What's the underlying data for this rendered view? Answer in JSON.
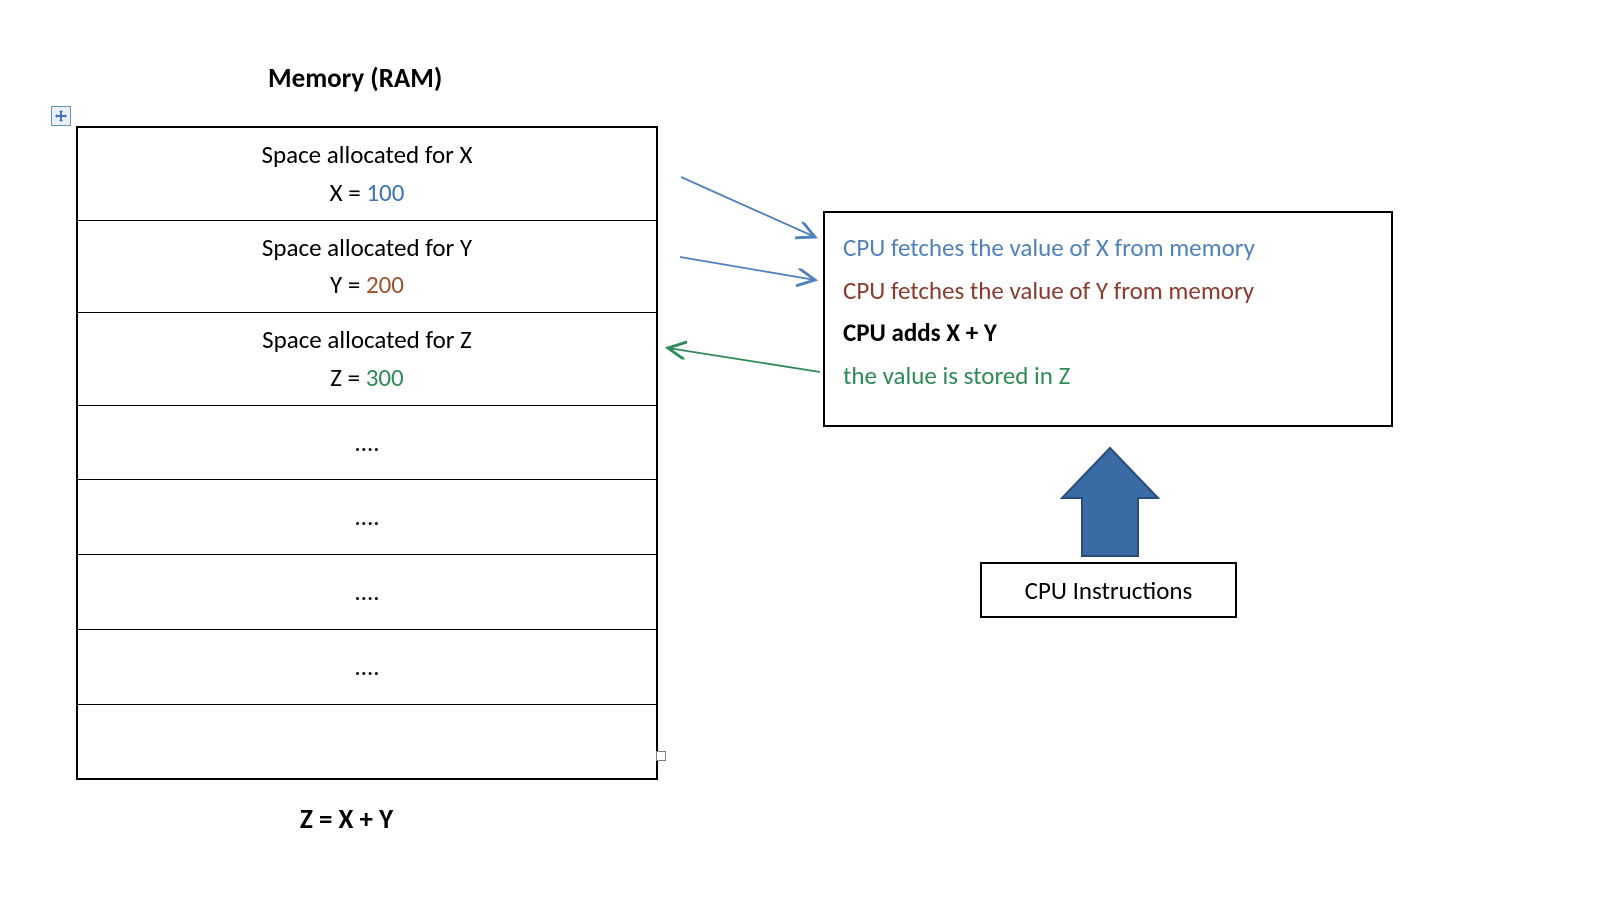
{
  "ram": {
    "title": "Memory (RAM)",
    "cells": [
      {
        "alloc": "Space allocated for X",
        "var": "X = ",
        "value": "100",
        "color": "c-blue"
      },
      {
        "alloc": "Space allocated for Y",
        "var": "Y = ",
        "value": "200",
        "color": "c-brown"
      },
      {
        "alloc": "Space allocated for Z",
        "var": "Z = ",
        "value": "300",
        "color": "c-green"
      }
    ],
    "ellipsis": "....",
    "equation": "Z = X + Y"
  },
  "steps": {
    "s1": "CPU fetches the value of X from memory",
    "s2": "CPU fetches the value of Y from memory",
    "s3": "CPU adds X + Y",
    "s4": "the value is stored in Z"
  },
  "cpu_box": "CPU Instructions",
  "colors": {
    "arrow_blue": "#4f81bd",
    "arrow_green": "#2e8b57",
    "block_arrow": "#3b6ba5"
  }
}
